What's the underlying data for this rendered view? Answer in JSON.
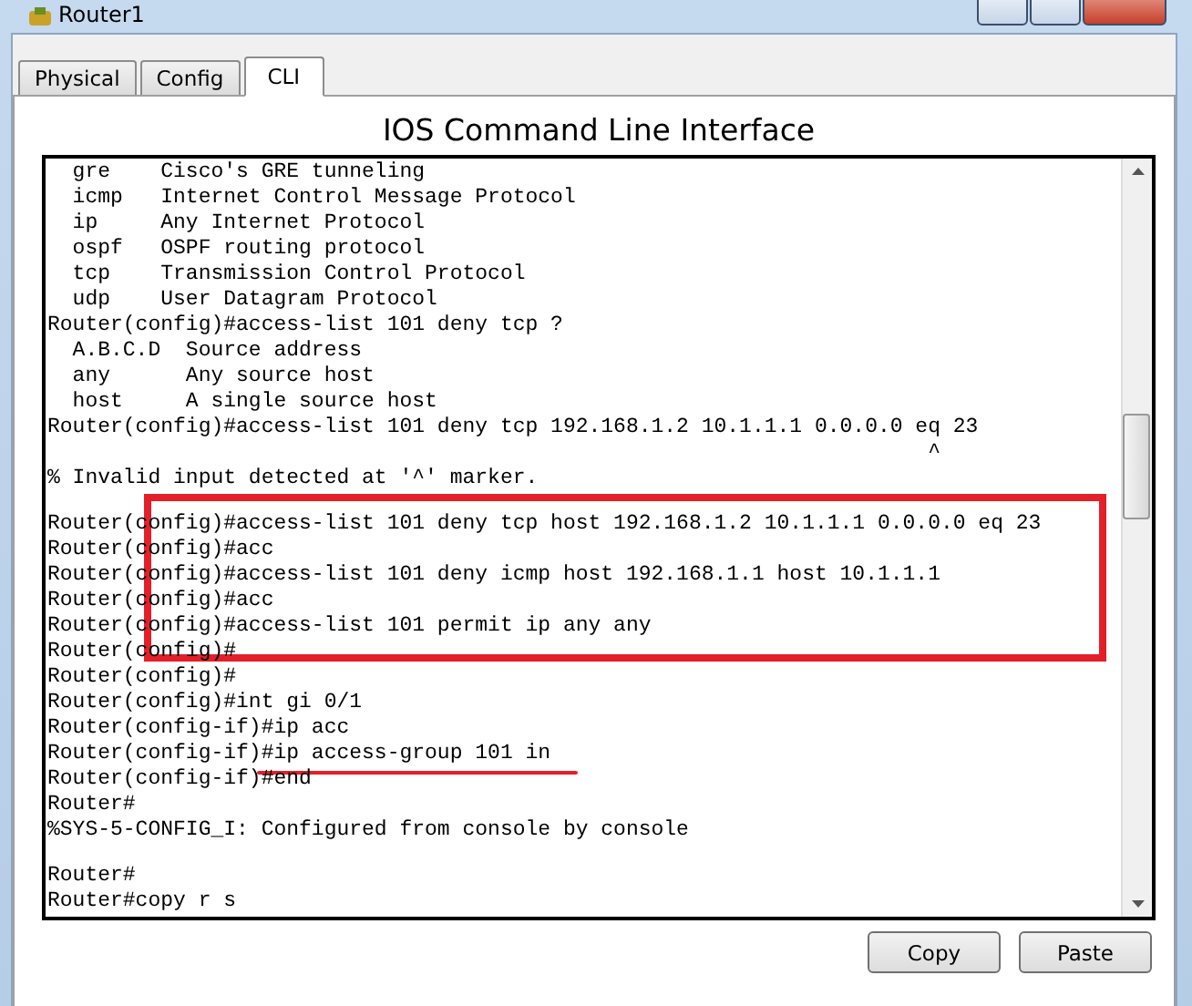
{
  "window": {
    "title": "Router1"
  },
  "tabs": [
    {
      "label": "Physical",
      "selected": false
    },
    {
      "label": "Config",
      "selected": false
    },
    {
      "label": "CLI",
      "selected": true
    }
  ],
  "heading": "IOS Command Line Interface",
  "terminal": {
    "lines": [
      {
        "kind": "text",
        "text": "  gre    Cisco's GRE tunneling"
      },
      {
        "kind": "text",
        "text": "  icmp   Internet Control Message Protocol"
      },
      {
        "kind": "text",
        "text": "  ip     Any Internet Protocol"
      },
      {
        "kind": "text",
        "text": "  ospf   OSPF routing protocol"
      },
      {
        "kind": "text",
        "text": "  tcp    Transmission Control Protocol"
      },
      {
        "kind": "text",
        "text": "  udp    User Datagram Protocol"
      },
      {
        "kind": "text",
        "text": "Router(config)#access-list 101 deny tcp ?"
      },
      {
        "kind": "text",
        "text": "  A.B.C.D  Source address"
      },
      {
        "kind": "text",
        "text": "  any      Any source host"
      },
      {
        "kind": "text",
        "text": "  host     A single source host"
      },
      {
        "kind": "text",
        "text": "Router(config)#access-list 101 deny tcp 192.168.1.2 10.1.1.1 0.0.0.0 eq 23"
      },
      {
        "kind": "text",
        "text": "                                                                      ^"
      },
      {
        "kind": "text",
        "text": "% Invalid input detected at '^' marker."
      },
      {
        "kind": "blank"
      },
      {
        "kind": "text",
        "text": "Router(config)#access-list 101 deny tcp host 192.168.1.2 10.1.1.1 0.0.0.0 eq 23"
      },
      {
        "kind": "text",
        "text": "Router(config)#acc"
      },
      {
        "kind": "text",
        "text": "Router(config)#access-list 101 deny icmp host 192.168.1.1 host 10.1.1.1"
      },
      {
        "kind": "text",
        "text": "Router(config)#acc"
      },
      {
        "kind": "text",
        "text": "Router(config)#access-list 101 permit ip any any"
      },
      {
        "kind": "text",
        "text": "Router(config)#"
      },
      {
        "kind": "text",
        "text": "Router(config)#"
      },
      {
        "kind": "text",
        "text": "Router(config)#int gi 0/1"
      },
      {
        "kind": "text",
        "text": "Router(config-if)#ip acc"
      },
      {
        "kind": "text",
        "text": "Router(config-if)#ip access-group 101 in"
      },
      {
        "kind": "text",
        "text": "Router(config-if)#end"
      },
      {
        "kind": "text",
        "text": "Router#"
      },
      {
        "kind": "text",
        "text": "%SYS-5-CONFIG_I: Configured from console by console"
      },
      {
        "kind": "blank"
      },
      {
        "kind": "text",
        "text": "Router#"
      },
      {
        "kind": "text",
        "text": "Router#copy r s"
      }
    ]
  },
  "buttons": [
    "Copy",
    "Paste"
  ]
}
